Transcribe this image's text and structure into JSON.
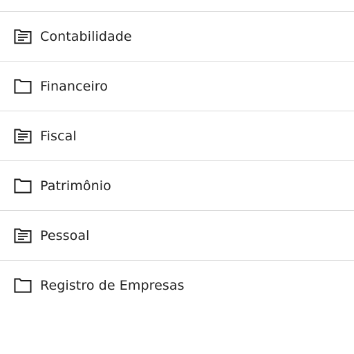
{
  "items": [
    {
      "label": "Contabilidade",
      "icon": "document-folder-icon"
    },
    {
      "label": "Financeiro",
      "icon": "folder-icon"
    },
    {
      "label": "Fiscal",
      "icon": "document-folder-icon"
    },
    {
      "label": "Patrimônio",
      "icon": "folder-icon"
    },
    {
      "label": "Pessoal",
      "icon": "document-folder-icon"
    },
    {
      "label": "Registro de Empresas",
      "icon": "folder-icon"
    }
  ],
  "colors": {
    "text": "#222222",
    "divider": "#d9d9d9",
    "icon": "#1a1a1a",
    "background": "#ffffff"
  }
}
